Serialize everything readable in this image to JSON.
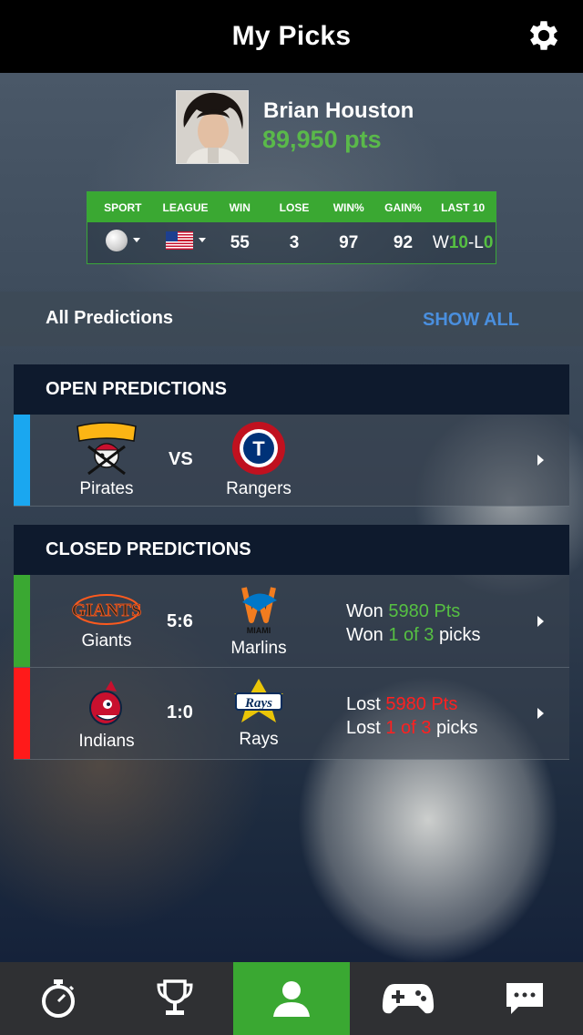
{
  "header": {
    "title": "My Picks"
  },
  "user": {
    "name": "Brian Houston",
    "points": "89,950 pts"
  },
  "stats": {
    "headers": [
      "SPORT",
      "LEAGUE",
      "WIN",
      "LOSE",
      "WIN%",
      "GAIN%",
      "LAST 10"
    ],
    "win": "55",
    "lose": "3",
    "win_pct": "97",
    "gain_pct": "92",
    "last10": {
      "w": "W",
      "wn": "10",
      "sep": "-L",
      "ln": "0"
    }
  },
  "all_predictions": {
    "title": "All Predictions",
    "show_all": "SHOW ALL"
  },
  "open": {
    "title": "OPEN PREDICTIONS",
    "items": [
      {
        "home": "Pirates",
        "away": "Rangers",
        "vs": "VS"
      }
    ]
  },
  "closed": {
    "title": "CLOSED PREDICTIONS",
    "items": [
      {
        "home": "Giants",
        "away": "Marlins",
        "score": "5:6",
        "line1_prefix": "Won",
        "line1_value": "5980 Pts",
        "line2_prefix": "Won",
        "line2_value": "1 of 3",
        "line2_suffix": "picks"
      },
      {
        "home": "Indians",
        "away": "Rays",
        "score": "1:0",
        "line1_prefix": "Lost",
        "line1_value": "5980 Pts",
        "line2_prefix": "Lost",
        "line2_value": "1 of 3",
        "line2_suffix": "picks"
      }
    ]
  },
  "colors": {
    "accent": "#3aa832",
    "open_stripe": "#1aa7f0",
    "won": "#3aa832",
    "lost": "#ff1a1a",
    "link": "#4a8fde"
  },
  "nav": [
    "stopwatch-icon",
    "trophy-icon",
    "user-icon",
    "gamepad-icon",
    "chat-icon"
  ]
}
